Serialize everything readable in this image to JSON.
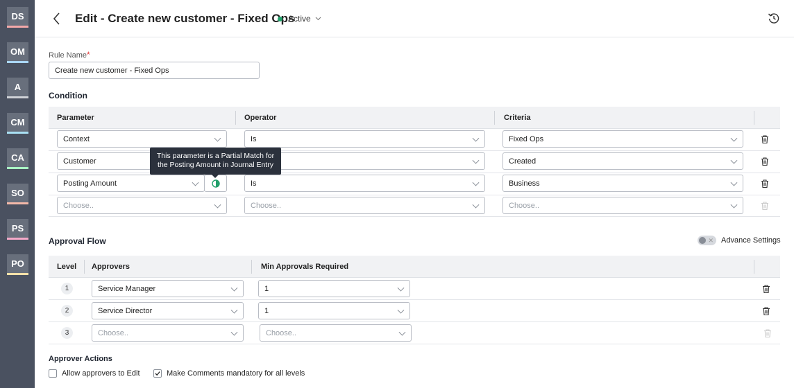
{
  "rail": {
    "items": [
      {
        "label": "DS",
        "color": "#f4a9a9"
      },
      {
        "label": "OM",
        "color": "#a9d6f4"
      },
      {
        "label": "A",
        "color": "#cfd2d7"
      },
      {
        "label": "CM",
        "color": "#a9e0f4"
      },
      {
        "label": "CA",
        "color": "#a9f4c4"
      },
      {
        "label": "SO",
        "color": "#f4b9a9"
      },
      {
        "label": "PS",
        "color": "#f4a9c9"
      },
      {
        "label": "PO",
        "color": "#f4e0a9"
      }
    ]
  },
  "header": {
    "back_icon": "chevron-left-icon",
    "title": "Edit - Create new customer - Fixed Ops",
    "status": "Active",
    "history_icon": "history-icon"
  },
  "rule": {
    "label": "Rule Name",
    "required_mark": "*",
    "value": "Create new customer - Fixed Ops"
  },
  "condition": {
    "title": "Condition",
    "headers": [
      "Parameter",
      "Operator",
      "Criteria"
    ],
    "rows": [
      {
        "parameter": "Context",
        "operator": "Is",
        "criteria": "Fixed Ops"
      },
      {
        "parameter": "Customer",
        "operator": "",
        "criteria": "Created"
      },
      {
        "parameter": "Posting Amount",
        "operator": "Is",
        "criteria": "Business"
      },
      {
        "parameter": "Choose..",
        "operator": "Choose..",
        "criteria": "Choose.."
      }
    ],
    "tooltip": "This parameter is a Partial Match for the Posting Amount in Journal Entry"
  },
  "approval": {
    "title": "Approval Flow",
    "advance_settings": "Advance Settings",
    "headers": [
      "Level",
      "Approvers",
      "Min Approvals Required"
    ],
    "rows": [
      {
        "level": "1",
        "approver": "Service Manager",
        "min": "1"
      },
      {
        "level": "2",
        "approver": "Service Director",
        "min": "1"
      },
      {
        "level": "3",
        "approver": "Choose..",
        "min": "Choose.."
      }
    ]
  },
  "actions": {
    "title": "Approver Actions",
    "allow_edit": {
      "label": "Allow approvers to Edit",
      "checked": false
    },
    "comments": {
      "label": "Make Comments mandatory for all levels",
      "checked": true
    }
  }
}
